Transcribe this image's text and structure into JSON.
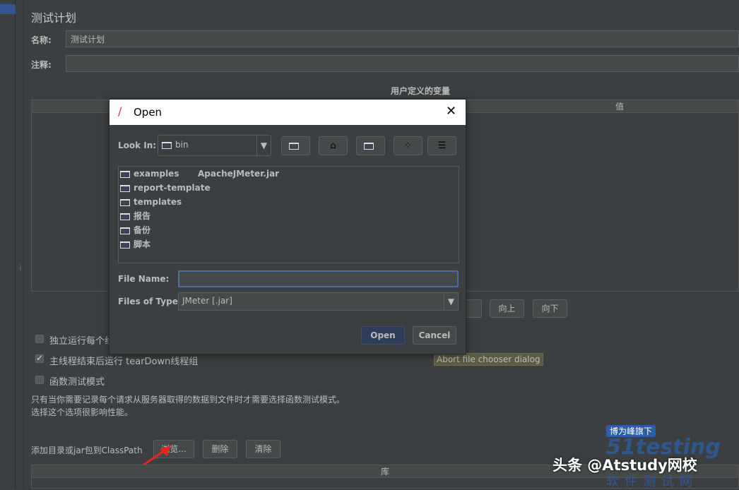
{
  "plan": {
    "title": "测试计划",
    "name_label": "名称:",
    "name_value": "测试计划",
    "comment_label": "注释:",
    "comment_value": "",
    "vars_title": "用户定义的变量",
    "vars_col_value": "值",
    "buttons": {
      "delete": "删除",
      "up": "向上",
      "down": "向下"
    },
    "checkbox_independent": {
      "label": "独立运行每个线程组",
      "checked": false
    },
    "checkbox_teardown": {
      "label": "主线程结束后运行 tearDown线程组",
      "checked": true
    },
    "checkbox_functional": {
      "label": "函数测试模式",
      "checked": false
    },
    "note_line1": "只有当你需要记录每个请求从服务器取得的数据到文件时才需要选择函数测试模式。",
    "note_line2": "选择这个选项很影响性能。",
    "classpath_label": "添加目录或jar包到ClassPath",
    "classpath_browse": "浏览...",
    "classpath_delete": "删除",
    "classpath_clear": "清除",
    "lib_col": "库"
  },
  "dialog": {
    "title": "Open",
    "look_in_label": "Look In:",
    "look_in_value": "bin",
    "files": [
      {
        "name": "examples",
        "type": "folder"
      },
      {
        "name": "report-template",
        "type": "folder"
      },
      {
        "name": "templates",
        "type": "folder"
      },
      {
        "name": "报告",
        "type": "folder"
      },
      {
        "name": "备份",
        "type": "folder"
      },
      {
        "name": "脚本",
        "type": "folder"
      },
      {
        "name": "ApacheJMeter.jar",
        "type": "file"
      }
    ],
    "file_name_label": "File Name:",
    "file_name_value": "",
    "files_of_type_label": "Files of Type:",
    "files_of_type_value": "JMeter [.jar]",
    "open": "Open",
    "cancel": "Cancel"
  },
  "tooltip": "Abort file chooser dialog",
  "watermark": {
    "logo_top": "博为峰旗下",
    "logo_main": "51testing",
    "logo_sub": "软件测试网",
    "credit": "头条 @Atstudy网校"
  },
  "colors": {
    "accent": "#2f65ca",
    "open_button": "#2d3e5a",
    "tooltip_bg": "#5c5c42"
  }
}
